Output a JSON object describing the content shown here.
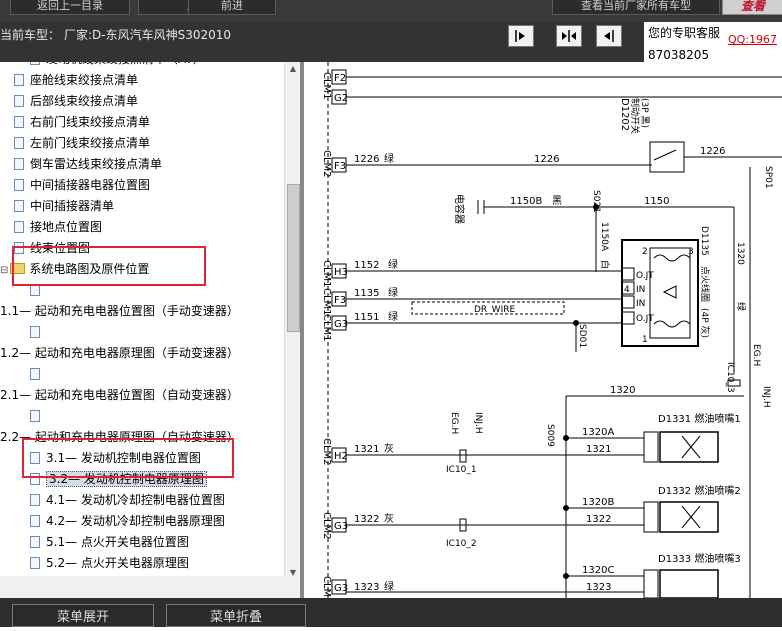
{
  "top_buttons": [
    {
      "label": "返回上一目录",
      "style": "dark"
    },
    {
      "label": "后退",
      "style": "dark"
    },
    {
      "label": "前进",
      "style": "dark"
    },
    {
      "label": "查看当前厂家所有车型",
      "style": "dark"
    },
    {
      "label": "查看",
      "style": "pink"
    }
  ],
  "info": {
    "model_prefix": "当前车型：",
    "model_value": "厂家:D-东风汽车风神S302010"
  },
  "service": {
    "label": "您的专职客服",
    "qq": "QQ:1967",
    "number": "87038205"
  },
  "tree": [
    {
      "label": "发动机线束绞接点清单（AT）",
      "indent": 30,
      "type": "doc",
      "selected": false
    },
    {
      "label": "座舱线束绞接点清单",
      "indent": 14,
      "type": "doc",
      "selected": false
    },
    {
      "label": "后部线束绞接点清单",
      "indent": 14,
      "type": "doc",
      "selected": false
    },
    {
      "label": "右前门线束绞接点清单",
      "indent": 14,
      "type": "doc",
      "selected": false
    },
    {
      "label": "左前门线束绞接点清单",
      "indent": 14,
      "type": "doc",
      "selected": false
    },
    {
      "label": "倒车雷达线束绞接点清单",
      "indent": 14,
      "type": "doc",
      "selected": false
    },
    {
      "label": "中间插接器电器位置图",
      "indent": 14,
      "type": "doc",
      "selected": false
    },
    {
      "label": "中间插接器清单",
      "indent": 14,
      "type": "doc",
      "selected": false
    },
    {
      "label": "接地点位置图",
      "indent": 14,
      "type": "doc",
      "selected": false
    },
    {
      "label": "线束位置图",
      "indent": 14,
      "type": "doc",
      "selected": false
    },
    {
      "label": "系统电路图及原件位置",
      "indent": 14,
      "type": "folder",
      "selected": false
    },
    {
      "label": "",
      "indent": 30,
      "type": "doc",
      "selected": false
    },
    {
      "label": "1.1— 起动和充电电器位置图（手动变速器）",
      "indent": 0,
      "type": "text",
      "selected": false
    },
    {
      "label": "",
      "indent": 30,
      "type": "doc",
      "selected": false
    },
    {
      "label": "1.2— 起动和充电电器原理图（手动变速器）",
      "indent": 0,
      "type": "text",
      "selected": false
    },
    {
      "label": "",
      "indent": 30,
      "type": "doc",
      "selected": false
    },
    {
      "label": "2.1— 起动和充电电器位置图（自动变速器）",
      "indent": 0,
      "type": "text",
      "selected": false
    },
    {
      "label": "",
      "indent": 30,
      "type": "doc",
      "selected": false
    },
    {
      "label": "2.2— 起动和充电电器原理图（自动变速器）",
      "indent": 0,
      "type": "text",
      "selected": false
    },
    {
      "label": "3.1— 发动机控制电器位置图",
      "indent": 30,
      "type": "doc",
      "selected": false
    },
    {
      "label": "3.2— 发动机控制电器原理图",
      "indent": 30,
      "type": "doc",
      "selected": true
    },
    {
      "label": "4.1— 发动机冷却控制电器位置图",
      "indent": 30,
      "type": "doc",
      "selected": false
    },
    {
      "label": "4.2— 发动机冷却控制电器原理图",
      "indent": 30,
      "type": "doc",
      "selected": false
    },
    {
      "label": "5.1— 点火开关电器位置图",
      "indent": 30,
      "type": "doc",
      "selected": false
    },
    {
      "label": "5.2— 点火开关电器原理图",
      "indent": 30,
      "type": "doc",
      "selected": false
    },
    {
      "label": "6.1— 自动变速器电器位置图",
      "indent": 30,
      "type": "doc",
      "selected": false
    },
    {
      "label": "6.2— 自动变速器电器原理图",
      "indent": 30,
      "type": "doc",
      "selected": false
    }
  ],
  "diagram": {
    "conn_left": [
      "CLM1",
      "CLM2",
      "CLM1",
      "CLM1",
      "CLM1",
      "CLM2",
      "CLM2",
      "CLM2"
    ],
    "pins": [
      "F2",
      "G2",
      "F3",
      "H3",
      "F3",
      "G3",
      "H2",
      "G3",
      "G3"
    ],
    "wire_nums": [
      "1226",
      "1226",
      "1226",
      "1150B",
      "1150",
      "1150A",
      "1152",
      "1135",
      "1151",
      "1320",
      "1320A",
      "1321",
      "1320B",
      "1322",
      "1320C",
      "1323",
      "1321",
      "1322",
      "1323",
      "1320"
    ],
    "colors": [
      "绿",
      "黑",
      "白",
      "绿",
      "绿",
      "绿",
      "灰",
      "灰",
      "绿",
      "绿"
    ],
    "splices": [
      "S021",
      "SD01",
      "S009",
      "SP01"
    ],
    "component_brake": [
      "D1202",
      "制动开关",
      "(3P 黑)"
    ],
    "capacitor": "电容器",
    "coil": [
      "D1135",
      "点火线圈",
      "(4P 灰)"
    ],
    "coil_pins": [
      "O.JT",
      "IN",
      "IN",
      "O.JT"
    ],
    "coil_nums": [
      "2",
      "3",
      "4",
      "1"
    ],
    "dr_wire": "DR_WIRE",
    "injectors": [
      "D1331 燃油喷嘴1",
      "D1332 燃油喷嘴2",
      "D1333 燃油喷嘴3"
    ],
    "ic_labels": [
      "IC10_1",
      "IC10_2",
      "IC10_3"
    ],
    "egh": [
      "EG.H",
      "INJ.H"
    ]
  },
  "bottom": {
    "expand": "菜单展开",
    "collapse": "菜单折叠"
  }
}
